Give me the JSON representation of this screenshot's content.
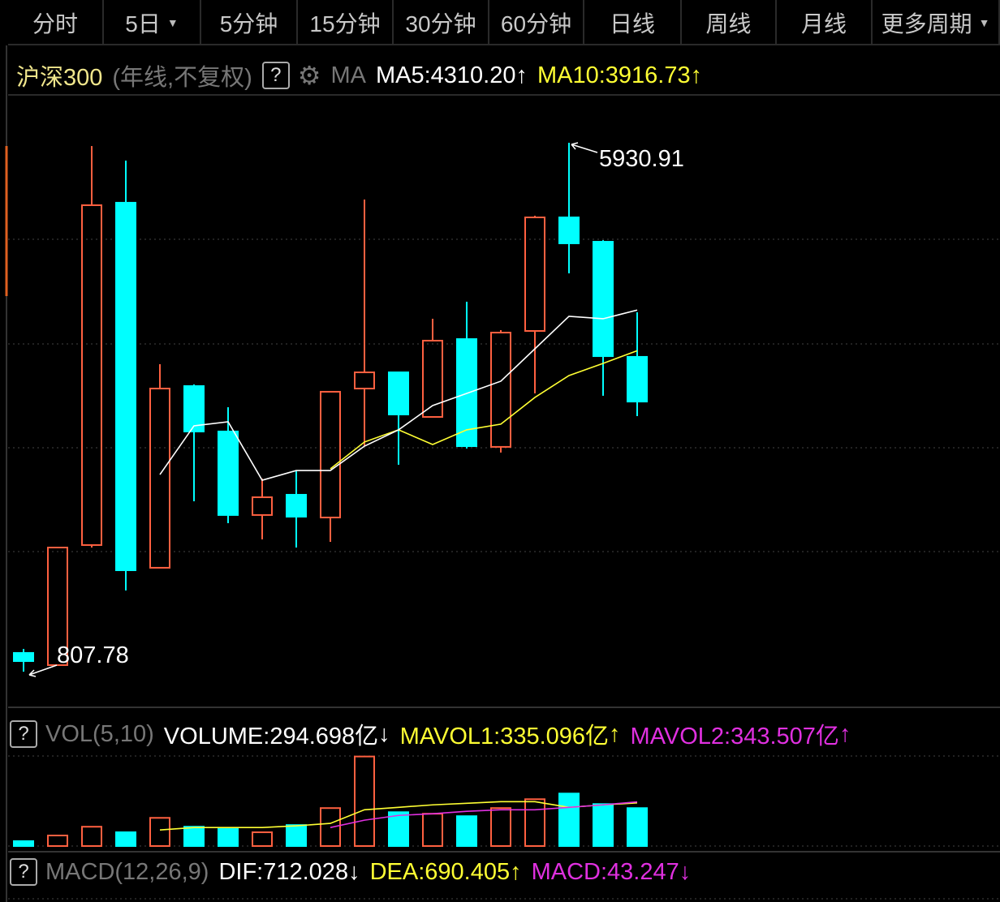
{
  "tabs": [
    {
      "label": "分时"
    },
    {
      "label": "5日",
      "dropdown": true
    },
    {
      "label": "5分钟"
    },
    {
      "label": "15分钟"
    },
    {
      "label": "30分钟"
    },
    {
      "label": "60分钟"
    },
    {
      "label": "日线"
    },
    {
      "label": "周线"
    },
    {
      "label": "月线"
    },
    {
      "label": "更多周期",
      "dropdown": true
    }
  ],
  "info": {
    "name": "沪深300",
    "mode": "(年线,不复权)",
    "help": "?",
    "ma": "MA",
    "ma5": "MA5:4310.20",
    "ma5_arrow": "↑",
    "ma10": "MA10:3916.73",
    "ma10_arrow": "↑"
  },
  "annotations": {
    "high": "5930.91",
    "low": "807.78"
  },
  "vol": {
    "help": "?",
    "name": "VOL(5,10)",
    "volume": "VOLUME:294.698亿",
    "volume_arrow": "↓",
    "mavol1": "MAVOL1:335.096亿",
    "mavol1_arrow": "↑",
    "mavol2": "MAVOL2:343.507亿",
    "mavol2_arrow": "↑"
  },
  "macd": {
    "help": "?",
    "name": "MACD(12,26,9)",
    "dif": "DIF:712.028",
    "dif_arrow": "↓",
    "dea": "DEA:690.405",
    "dea_arrow": "↑",
    "macd": "MACD:43.247",
    "macd_arrow": "↓"
  },
  "colors": {
    "up": "#ff6040",
    "down": "#00ffff",
    "ma5": "#ffffff",
    "ma10": "#ffff33",
    "mavol2": "#e030e0"
  },
  "chart_data": {
    "type": "candlestick",
    "price_range": [
      807.78,
      5930.91
    ],
    "candles": [
      {
        "o": 989,
        "c": 910,
        "h": 1028,
        "l": 807.78
      },
      {
        "o": 871,
        "c": 2010,
        "h": 2010,
        "l": 871
      },
      {
        "o": 2034,
        "c": 5326,
        "h": 5899,
        "l": 2010
      },
      {
        "o": 5350,
        "c": 1790,
        "h": 5758,
        "l": 1594
      },
      {
        "o": 1814,
        "c": 3550,
        "h": 3786,
        "l": 1814
      },
      {
        "o": 3574,
        "c": 3134,
        "h": 3590,
        "l": 2458
      },
      {
        "o": 3134,
        "c": 2325,
        "h": 3369,
        "l": 2246
      },
      {
        "o": 2325,
        "c": 2497,
        "h": 2678,
        "l": 2089
      },
      {
        "o": 2521,
        "c": 2309,
        "h": 2757,
        "l": 2010
      },
      {
        "o": 2301,
        "c": 3519,
        "h": 3519,
        "l": 2065
      },
      {
        "o": 3550,
        "c": 3707,
        "h": 5381,
        "l": 2992
      },
      {
        "o": 3707,
        "c": 3299,
        "h": 3707,
        "l": 2812
      },
      {
        "o": 3275,
        "c": 4014,
        "h": 4226,
        "l": 3275
      },
      {
        "o": 4029,
        "c": 2992,
        "h": 4391,
        "l": 2969
      },
      {
        "o": 2985,
        "c": 4092,
        "h": 4116,
        "l": 2930
      },
      {
        "o": 4108,
        "c": 5208,
        "h": 5224,
        "l": 3503
      },
      {
        "o": 5208,
        "c": 4957,
        "h": 5930.91,
        "l": 4666
      },
      {
        "o": 4972,
        "c": 3864,
        "h": 4987,
        "l": 3480
      },
      {
        "o": 3857,
        "c": 3424,
        "h": 4289,
        "l": 3283
      }
    ],
    "ma5": [
      null,
      null,
      null,
      null,
      2717,
      3189,
      3228,
      2662,
      2756,
      2756,
      2992,
      3150,
      3385,
      3503,
      3621,
      3935,
      4250,
      4226,
      4310.2
    ],
    "ma10": [
      null,
      null,
      null,
      null,
      null,
      null,
      null,
      null,
      null,
      2772,
      3032,
      3150,
      3008,
      3150,
      3205,
      3464,
      3676,
      3794,
      3916.73
    ],
    "volume": [
      38,
      82,
      150,
      107,
      219,
      150,
      132,
      107,
      163,
      295,
      696,
      263,
      251,
      232,
      295,
      364,
      408,
      326,
      294.698
    ],
    "volume_range": [
      0,
      700
    ],
    "mavol1": [
      null,
      null,
      null,
      null,
      125,
      144,
      144,
      144,
      157,
      176,
      282,
      301,
      320,
      332,
      345,
      345,
      301,
      320,
      335.096
    ],
    "mavol2": [
      null,
      null,
      null,
      null,
      null,
      null,
      null,
      null,
      null,
      144,
      201,
      238,
      251,
      270,
      282,
      282,
      301,
      320,
      343.507
    ]
  }
}
